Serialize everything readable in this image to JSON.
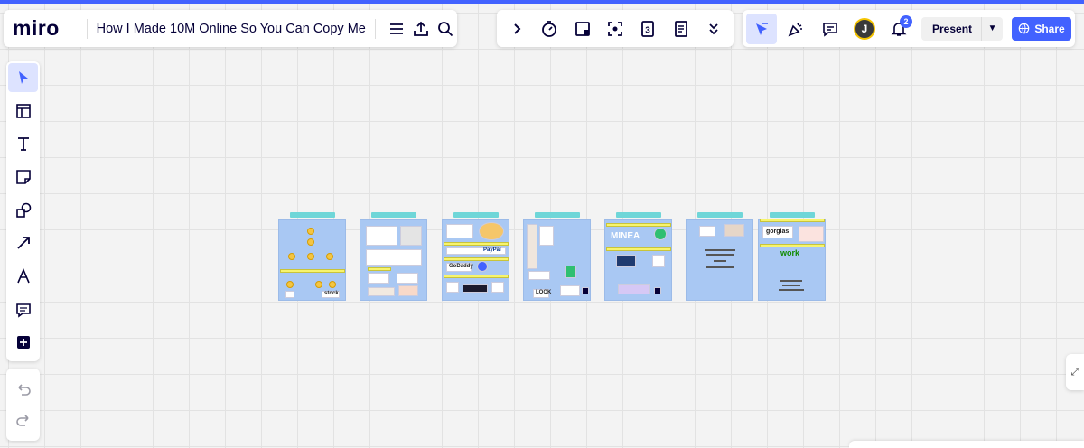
{
  "app": {
    "logo": "miro",
    "accent": "#4262ff"
  },
  "board": {
    "title": "How I Made 10M Online So You Can Copy Me"
  },
  "header_icons": [
    "menu-icon",
    "export-icon",
    "search-icon"
  ],
  "tools": [
    "chevron-right-icon",
    "timer-icon",
    "sticky-upload-icon",
    "focus-icon",
    "countdown-icon",
    "notes-icon",
    "chevron-double-down-icon"
  ],
  "tools_countdown_value": "3",
  "right_panel": {
    "avatar_initial": "J",
    "notifications_count": "2",
    "present_label": "Present",
    "share_label": "Share"
  },
  "left_toolbar": [
    "select-icon",
    "templates-icon",
    "text-icon",
    "sticky-note-icon",
    "shapes-icon",
    "arrow-icon",
    "pen-icon",
    "comment-icon",
    "add-icon"
  ],
  "undo_panel": [
    "undo-icon",
    "redo-icon"
  ],
  "frames": [
    {
      "id": "frame-1",
      "logo_texts": [
        "stock"
      ]
    },
    {
      "id": "frame-2",
      "logo_texts": []
    },
    {
      "id": "frame-3",
      "logo_texts": [
        "GoDaddy",
        "PayPal"
      ]
    },
    {
      "id": "frame-4",
      "logo_texts": [
        "LOOK"
      ]
    },
    {
      "id": "frame-5",
      "logo_texts": [
        "MINEA"
      ]
    },
    {
      "id": "frame-6",
      "logo_texts": []
    },
    {
      "id": "frame-7",
      "logo_texts": [
        "gorgias",
        "work"
      ]
    }
  ]
}
